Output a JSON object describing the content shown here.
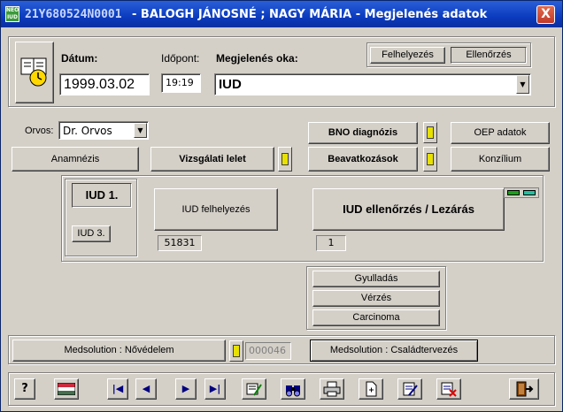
{
  "window": {
    "title_id": "21Y680524N0001",
    "title_text": "- BALOGH JÁNOSNÉ ; NAGY MÁRIA  - Megjelenés adatok",
    "close_label": "X"
  },
  "visit": {
    "date_label": "Dátum:",
    "date_value": "1999.03.02",
    "time_label": "Időpont:",
    "time_value": "19:19",
    "reason_label": "Megjelenés oka:",
    "reason_value": "IUD",
    "toggle_placement": "Felhelyezés",
    "toggle_check": "Ellenőrzés"
  },
  "doctor": {
    "label": "Orvos:",
    "value": "Dr. Orvos"
  },
  "buttons": {
    "bno": "BNO diagnózis",
    "oep": "OEP adatok",
    "anamnesis": "Anamnézis",
    "exam_result": "Vizsgálati lelet",
    "interventions": "Beavatkozások",
    "consilium": "Konzílium"
  },
  "iud": {
    "tab1": "IUD 1.",
    "tab3": "IUD 3.",
    "placement_button": "IUD felhelyezés",
    "placement_value": "51831",
    "check_button": "IUD ellenőrzés / Lezárás",
    "check_value": "1"
  },
  "findings": {
    "inflammation": "Gyulladás",
    "bleeding": "Vérzés",
    "carcinoma": "Carcinoma"
  },
  "medsolution": {
    "womens_care": "Medsolution : Nővédelem",
    "womens_care_code": "000046",
    "family_planning": "Medsolution : Családtervezés"
  },
  "toolbar": {
    "help": "?",
    "first": "|◀",
    "prev": "◀",
    "next": "▶",
    "last": "▶|"
  },
  "colors": {
    "title_gradient_start": "#2a5fd8",
    "title_gradient_end": "#0a2f9f",
    "face": "#d4d0c8",
    "indicator": "#e8e100"
  }
}
